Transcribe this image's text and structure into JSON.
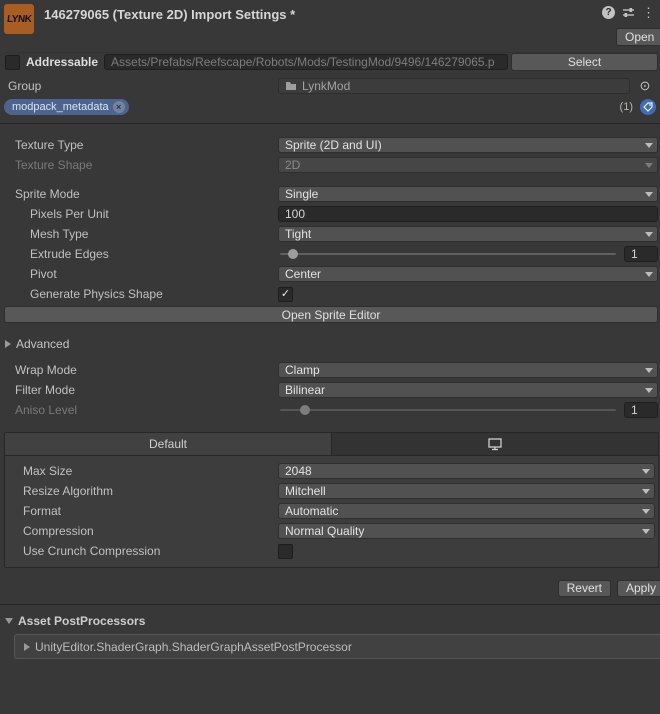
{
  "colors": {
    "background": "#383838",
    "logo_orange": "#a85d22",
    "chip_blue": "#4c648e",
    "tag_button_blue": "#3e6cb8"
  },
  "header": {
    "logo_text": "LYNK",
    "title": "146279065 (Texture 2D) Import Settings *",
    "help_icon": "?",
    "menu_icon": "⋮",
    "open_button": "Open"
  },
  "addressable": {
    "label": "Addressable",
    "path": "Assets/Prefabs/Reefscape/Robots/Mods/TestingMod/9496/146279065.p",
    "select_button": "Select"
  },
  "group": {
    "label": "Group",
    "value": "LynkMod",
    "picker_icon": "⊙"
  },
  "labels_row": {
    "chip": "modpack_metadata",
    "chip_close": "×",
    "count": "(1)"
  },
  "import": {
    "texture_type": {
      "label": "Texture Type",
      "value": "Sprite (2D and UI)"
    },
    "texture_shape": {
      "label": "Texture Shape",
      "value": "2D"
    },
    "sprite_mode": {
      "label": "Sprite Mode",
      "value": "Single"
    },
    "pixels_per_unit": {
      "label": "Pixels Per Unit",
      "value": "100"
    },
    "mesh_type": {
      "label": "Mesh Type",
      "value": "Tight"
    },
    "extrude_edges": {
      "label": "Extrude Edges",
      "value": "1"
    },
    "pivot": {
      "label": "Pivot",
      "value": "Center"
    },
    "generate_physics_shape": {
      "label": "Generate Physics Shape",
      "checked": true,
      "check_glyph": "✓"
    },
    "open_sprite_editor_button": "Open Sprite Editor",
    "advanced_label": "Advanced",
    "wrap_mode": {
      "label": "Wrap Mode",
      "value": "Clamp"
    },
    "filter_mode": {
      "label": "Filter Mode",
      "value": "Bilinear"
    },
    "aniso_level": {
      "label": "Aniso Level",
      "value": "1"
    }
  },
  "platform": {
    "default_tab": "Default",
    "standalone_tab_icon": "monitor",
    "max_size": {
      "label": "Max Size",
      "value": "2048"
    },
    "resize_algorithm": {
      "label": "Resize Algorithm",
      "value": "Mitchell"
    },
    "format": {
      "label": "Format",
      "value": "Automatic"
    },
    "compression": {
      "label": "Compression",
      "value": "Normal Quality"
    },
    "use_crunch_compression": {
      "label": "Use Crunch Compression",
      "checked": false
    }
  },
  "footer": {
    "revert_button": "Revert",
    "apply_button": "Apply"
  },
  "postprocessors": {
    "title": "Asset PostProcessors",
    "item": "UnityEditor.ShaderGraph.ShaderGraphAssetPostProcessor"
  }
}
